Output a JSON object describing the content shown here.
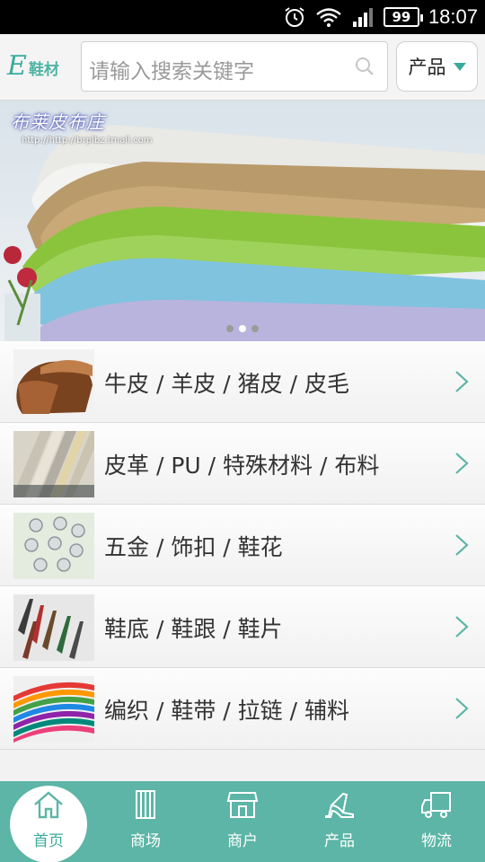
{
  "status_bar": {
    "battery": "99",
    "time": "18:07"
  },
  "header": {
    "logo_letter": "E",
    "logo_text": "鞋材",
    "search_placeholder": "请输入搜索关键字",
    "category_select": "产品"
  },
  "banner": {
    "brand_name": "布莱皮布庄",
    "brand_url": "http://http://brplbz.tmall.com",
    "slide_count": 3,
    "active_slide": 2
  },
  "categories": [
    {
      "label": "牛皮 / 羊皮 / 猪皮 / 皮毛",
      "thumb": "leather-swatch"
    },
    {
      "label": "皮革 / PU / 特殊材料 / 布料",
      "thumb": "pu-rolls"
    },
    {
      "label": "五金 / 饰扣 / 鞋花",
      "thumb": "rhinestone-buttons"
    },
    {
      "label": "鞋底 / 鞋跟 / 鞋片",
      "thumb": "shoe-heels"
    },
    {
      "label": "编织 / 鞋带 / 拉链 / 辅料",
      "thumb": "colored-laces"
    }
  ],
  "tabbar": {
    "items": [
      {
        "label": "首页",
        "icon": "home-icon",
        "active": true
      },
      {
        "label": "商场",
        "icon": "mall-icon",
        "active": false
      },
      {
        "label": "商户",
        "icon": "store-icon",
        "active": false
      },
      {
        "label": "产品",
        "icon": "high-heel-icon",
        "active": false
      },
      {
        "label": "物流",
        "icon": "truck-icon",
        "active": false
      }
    ]
  },
  "colors": {
    "accent": "#5cb5a6",
    "accent_dark": "#3aaa9c"
  }
}
